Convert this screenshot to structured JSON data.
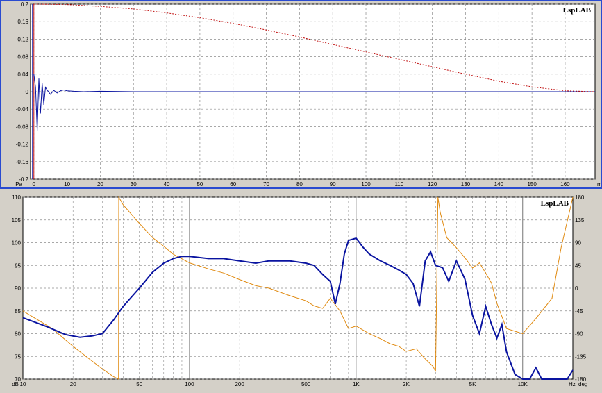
{
  "colors": {
    "panel_bg": "#d4d0c8",
    "plot_bg": "#ffffff",
    "grid": "#8c8c8c",
    "frame": "#2a4bd0",
    "series_blue": "#0a14a0",
    "series_red": "#c01010",
    "series_orange": "#e08a10",
    "axis_blue": "#1030c0",
    "axis_orange": "#e08a10"
  },
  "chart_data": [
    {
      "type": "line",
      "logo": "LspLAB",
      "x_unit": "ms",
      "y_unit": "Pa",
      "xlim": [
        -1,
        169
      ],
      "ylim": [
        -0.2,
        0.2
      ],
      "x_ticks": [
        0,
        10,
        20,
        30,
        40,
        50,
        60,
        70,
        80,
        90,
        100,
        110,
        120,
        130,
        140,
        150,
        160
      ],
      "y_ticks": [
        "0.2",
        "0.16",
        "0.12",
        "0.08",
        "0.04",
        "0",
        "-0.04",
        "-0.08",
        "-0.12",
        "-0.16",
        "-0.2"
      ],
      "y_tick_values": [
        0.2,
        0.16,
        0.12,
        0.08,
        0.04,
        0,
        -0.04,
        -0.08,
        -0.12,
        -0.16,
        -0.2
      ],
      "grid": true,
      "series": [
        {
          "color": "series_blue",
          "style": "solid",
          "x": [
            0,
            0.5,
            1,
            1.5,
            2,
            2.5,
            3,
            3.5,
            4,
            5,
            6,
            7,
            8,
            9,
            10,
            12,
            15,
            20,
            30,
            40,
            60,
            80,
            100,
            120,
            140,
            160,
            169
          ],
          "y": [
            0.04,
            0.01,
            -0.09,
            0.03,
            -0.05,
            0.02,
            -0.03,
            0.01,
            0.004,
            -0.006,
            0.003,
            -0.003,
            0.002,
            0.004,
            0.002,
            0.001,
            0,
            0.001,
            0,
            0,
            0,
            0,
            0,
            0,
            0,
            0,
            0
          ]
        },
        {
          "color": "series_red",
          "style": "dashed",
          "x": [
            0,
            10,
            20,
            30,
            40,
            50,
            60,
            70,
            80,
            90,
            100,
            110,
            120,
            130,
            140,
            150,
            160,
            169
          ],
          "y": [
            0.2,
            0.199,
            0.195,
            0.189,
            0.18,
            0.169,
            0.156,
            0.141,
            0.125,
            0.108,
            0.091,
            0.074,
            0.057,
            0.04,
            0.024,
            0.011,
            0.002,
            0
          ]
        }
      ]
    },
    {
      "type": "line",
      "logo": "LspLAB",
      "x_unit": "Hz",
      "y_unit_left": "dB",
      "y_unit_right": "deg",
      "x_scale": "log",
      "xlim": [
        10,
        20000
      ],
      "ylim": [
        70,
        110
      ],
      "ylim_right": [
        -180,
        180
      ],
      "x_ticks": [
        "10",
        "20",
        "50",
        "100",
        "200",
        "500",
        "1K",
        "2K",
        "5K",
        "10K"
      ],
      "x_tick_values": [
        10,
        20,
        50,
        100,
        200,
        500,
        1000,
        2000,
        5000,
        10000
      ],
      "y_ticks_left": [
        "110",
        "105",
        "100",
        "95",
        "90",
        "85",
        "80",
        "75",
        "70"
      ],
      "y_ticks_left_values": [
        110,
        105,
        100,
        95,
        90,
        85,
        80,
        75,
        70
      ],
      "y_ticks_right": [
        "180",
        "135",
        "90",
        "45",
        "0",
        "-45",
        "-90",
        "-135",
        "-180"
      ],
      "y_ticks_right_values": [
        180,
        135,
        90,
        45,
        0,
        -45,
        -90,
        -135,
        -180
      ],
      "grid": true,
      "series": [
        {
          "color": "series_blue",
          "axis": "left",
          "x": [
            10,
            14,
            18,
            22,
            26,
            30,
            35,
            40,
            50,
            60,
            70,
            80,
            90,
            100,
            130,
            160,
            200,
            250,
            300,
            400,
            500,
            560,
            630,
            700,
            750,
            800,
            850,
            900,
            1000,
            1100,
            1200,
            1400,
            1600,
            1800,
            2000,
            2200,
            2400,
            2600,
            2800,
            3000,
            3300,
            3600,
            4000,
            4500,
            5000,
            5500,
            6000,
            6500,
            7000,
            7500,
            8000,
            9000,
            10000,
            11000,
            12000,
            13000,
            15000,
            17000,
            18500,
            20000
          ],
          "y": [
            83.5,
            81.5,
            79.8,
            79.2,
            79.5,
            80,
            83,
            86,
            90,
            93.5,
            95.5,
            96.5,
            97,
            97,
            96.5,
            96.5,
            96,
            95.5,
            96,
            96,
            95.5,
            95,
            93,
            91.5,
            86.5,
            91,
            97.5,
            100.5,
            101,
            99,
            97.5,
            96,
            95,
            94,
            93,
            91,
            86,
            96,
            98,
            95,
            94.5,
            91.5,
            96,
            92,
            84,
            80,
            86,
            82,
            79,
            82,
            76,
            71,
            70,
            70,
            72.5,
            70,
            70,
            70,
            70,
            72
          ]
        },
        {
          "color": "series_orange",
          "axis": "right",
          "x": [
            10,
            15,
            20,
            25,
            30,
            35,
            37.5,
            37.6,
            40,
            50,
            60,
            70,
            80,
            100,
            130,
            160,
            200,
            250,
            300,
            400,
            500,
            560,
            630,
            700,
            800,
            900,
            1000,
            1200,
            1400,
            1600,
            1800,
            2000,
            2300,
            2600,
            2900,
            3000,
            3100,
            3200,
            3500,
            4000,
            4500,
            5000,
            5500,
            6000,
            6500,
            7000,
            8000,
            10000,
            12000,
            15000,
            17000,
            20000
          ],
          "y": [
            -45,
            -80,
            -115,
            -140,
            -160,
            -175,
            -180,
            180,
            165,
            128,
            100,
            83,
            67,
            50,
            38,
            30,
            17,
            5,
            0,
            -15,
            -25,
            -35,
            -40,
            -20,
            -45,
            -80,
            -75,
            -90,
            -100,
            -110,
            -115,
            -125,
            -120,
            -140,
            -155,
            -165,
            180,
            150,
            100,
            80,
            60,
            40,
            50,
            30,
            10,
            -30,
            -80,
            -90,
            -60,
            -20,
            80,
            180
          ]
        }
      ]
    }
  ]
}
